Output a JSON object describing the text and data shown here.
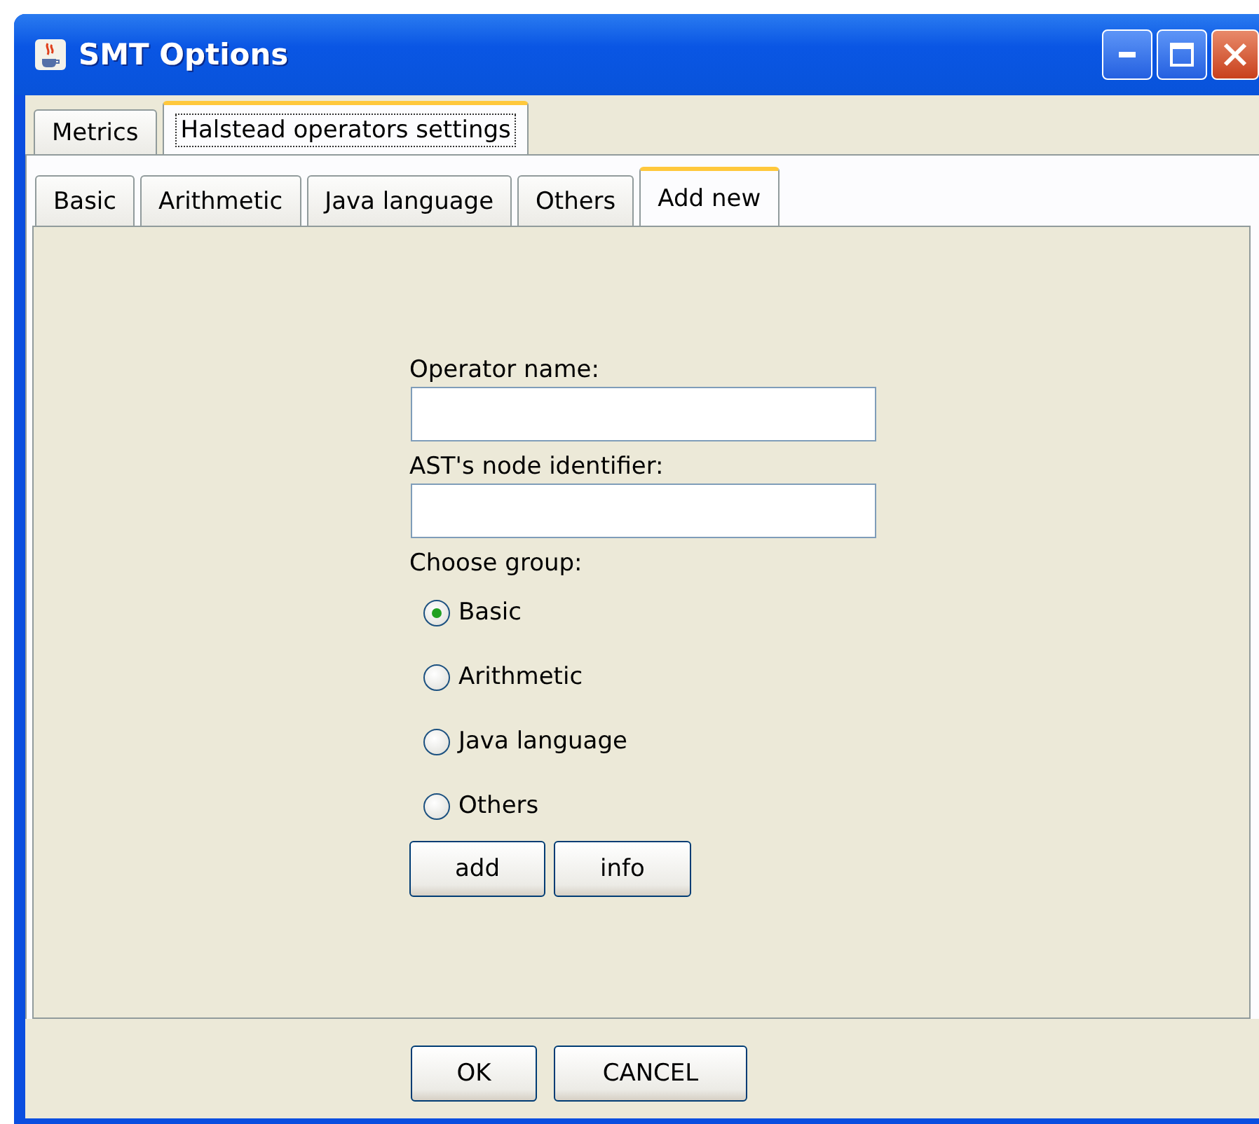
{
  "window": {
    "title": "SMT Options"
  },
  "tabs": [
    {
      "label": "Metrics",
      "selected": false
    },
    {
      "label": "Halstead operators settings",
      "selected": true
    }
  ],
  "subtabs": [
    {
      "label": "Basic",
      "selected": false
    },
    {
      "label": "Arithmetic",
      "selected": false
    },
    {
      "label": "Java language",
      "selected": false
    },
    {
      "label": "Others",
      "selected": false
    },
    {
      "label": "Add new",
      "selected": true
    }
  ],
  "form": {
    "fields": [
      {
        "label": "Operator name:"
      },
      {
        "label": "AST's node identifier:"
      }
    ],
    "group_label": "Choose group:",
    "groups": [
      {
        "label": "Basic",
        "selected": true
      },
      {
        "label": "Arithmetic",
        "selected": false
      },
      {
        "label": "Java language",
        "selected": false
      },
      {
        "label": "Others",
        "selected": false
      }
    ],
    "buttons": [
      "add",
      "info"
    ]
  },
  "footer_buttons": [
    "OK",
    "CANCEL"
  ]
}
